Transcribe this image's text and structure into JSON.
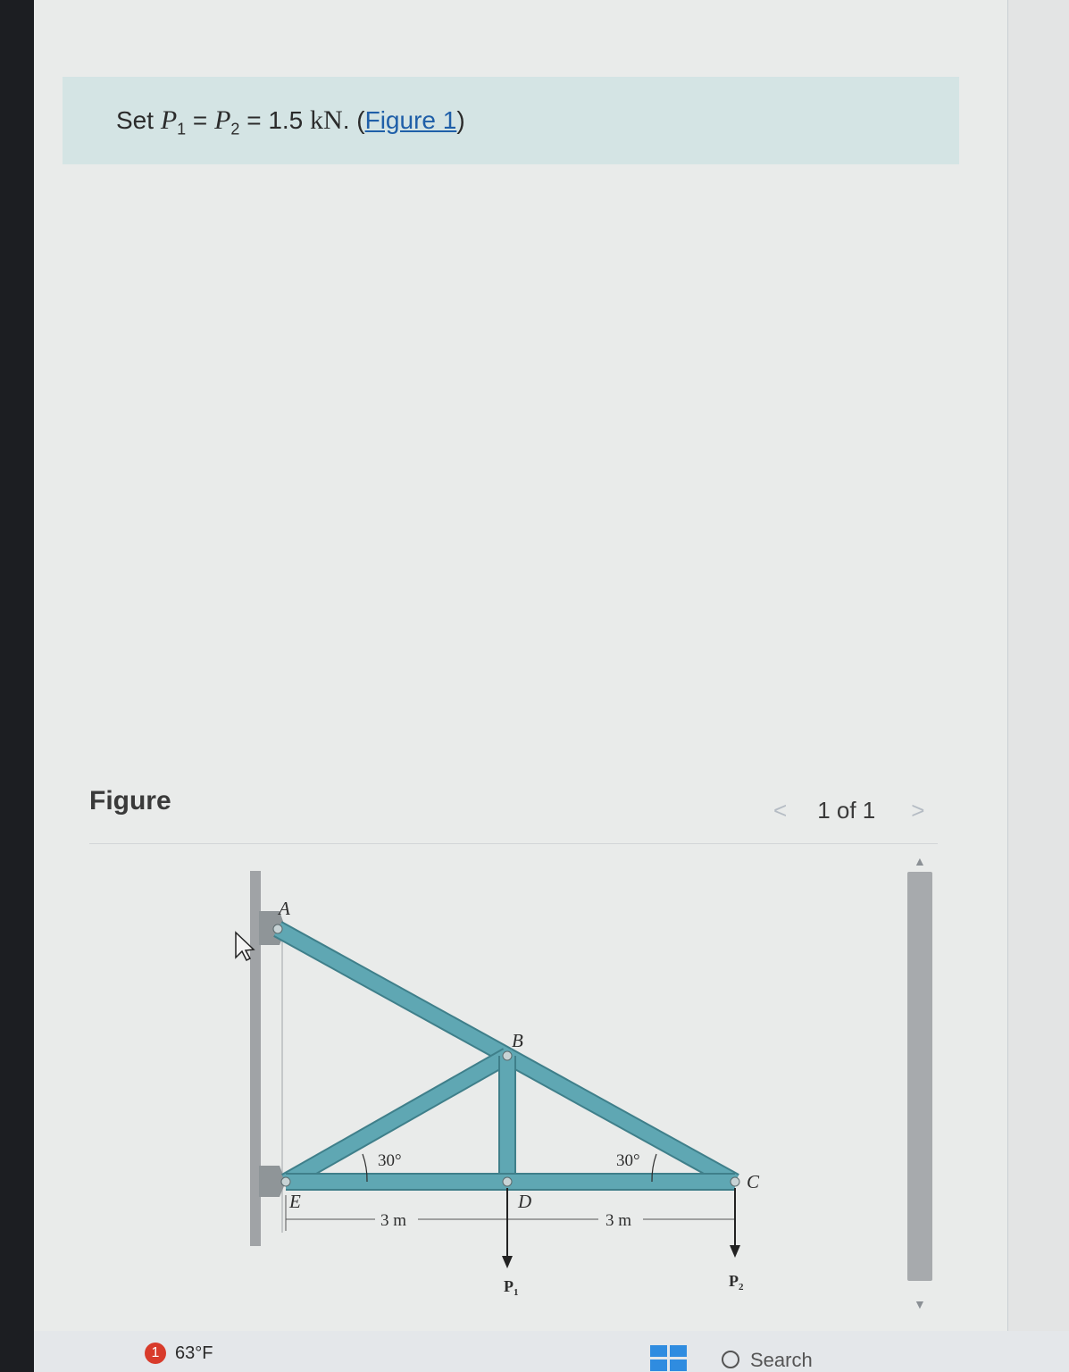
{
  "prompt": {
    "prefix": "Set ",
    "p1": "P",
    "p1_sub": "1",
    "equals": " = ",
    "p2": "P",
    "p2_sub": "2",
    "value": " = 1.5 ",
    "unit": "kN",
    "period": ". (",
    "figure_link": "Figure 1",
    "close": ")"
  },
  "figure_panel": {
    "heading": "Figure",
    "pager": {
      "prev": "<",
      "label": "1 of 1",
      "next": ">"
    }
  },
  "truss": {
    "node_labels": {
      "A": "A",
      "B": "B",
      "C": "C",
      "D": "D",
      "E": "E"
    },
    "angle_left": "30°",
    "angle_right": "30°",
    "dim_left": "3 m",
    "dim_right": "3 m",
    "load_1": "P",
    "load_1_sub": "1",
    "load_2": "P",
    "load_2_sub": "2",
    "member_color": "#5fa7b3",
    "member_edge_color": "#3f7f8a"
  },
  "taskbar": {
    "weather_badge": "1",
    "temperature": "63°F",
    "search_label": "Search"
  },
  "icons": [
    "windows-start-icon",
    "search-icon",
    "mouse-cursor-icon",
    "scroll-up-icon",
    "scroll-down-icon",
    "dropdown-arrow-icon"
  ]
}
